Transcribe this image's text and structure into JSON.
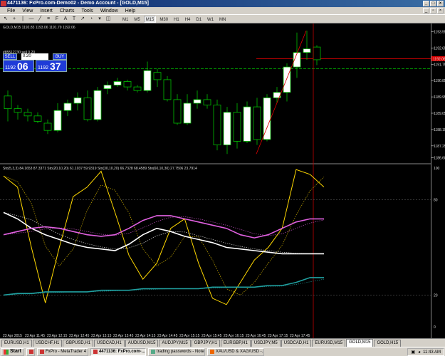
{
  "window": {
    "title": "4471136: FxPro.com-Demo02 - Demo Account - [GOLD,M15]"
  },
  "menu": [
    "File",
    "View",
    "Insert",
    "Charts",
    "Tools",
    "Window",
    "Help"
  ],
  "timeframes": [
    "M1",
    "M5",
    "M15",
    "M30",
    "H1",
    "H4",
    "D1",
    "W1",
    "MN"
  ],
  "active_timeframe": "M15",
  "chart": {
    "symbol_info": "GOLD,M15  1192.83 1193.06 1191.79 1192.06",
    "order_line_label": "#85512730 sell 0.20",
    "one_click": {
      "sell_label": "SELL",
      "buy_label": "BUY",
      "lot": "0.20",
      "sell_price_small": "1192",
      "sell_price_big": "06",
      "buy_price_small": "1192",
      "buy_price_big": "37"
    },
    "indicator_label": "Sto(5,3,3) 84.1653 87.3371  Sto(20,10,20) 61.1037 59.9319  Sto(30,10,20) 66.7328 68.4589  Sto(60,10,30) 27.7506 23.7914",
    "colors": {
      "background": "#000000",
      "bull_candle": "#ffffff",
      "bear_candle": "#000000",
      "candle_outline": "#00c000",
      "sto_5": "#ffd800",
      "sto_20": "#ffffff",
      "sto_30": "#e060e0",
      "sto_60": "#20a0a0",
      "order_line": "#00c000",
      "bid_line": "#ff0000",
      "crosshair": "#c00000"
    }
  },
  "chart_data": {
    "type": "candlestick",
    "price_levels": [
      "1193.55",
      "1192.65",
      "1191.75",
      "1190.85",
      "1189.95",
      "1189.05",
      "1188.15",
      "1187.25",
      "1186.60"
    ],
    "current_price_label": "1192.06",
    "crosshair_price_label": "1192.65",
    "indicator_levels": [
      "100",
      "80",
      "20",
      "0"
    ],
    "time_labels": [
      "23 Apr 2015",
      "23 Apr 11:45",
      "23 Apr 12:15",
      "23 Apr 12:45",
      "23 Apr 13:15",
      "23 Apr 13:45",
      "23 Apr 14:15",
      "23 Apr 14:45",
      "23 Apr 15:15",
      "23 Apr 15:45",
      "23 Apr 16:15",
      "23 Apr 16:45",
      "23 Apr 17:15",
      "23 Apr 17:45"
    ],
    "candles": [
      [
        1190.0,
        1190.3,
        1188.6,
        1189.3
      ],
      [
        1189.3,
        1189.5,
        1188.7,
        1189.1
      ],
      [
        1189.1,
        1189.3,
        1188.6,
        1188.9
      ],
      [
        1188.9,
        1189.1,
        1188.5,
        1188.6
      ],
      [
        1188.5,
        1188.7,
        1187.9,
        1188.1
      ],
      [
        1188.1,
        1189.6,
        1188.0,
        1189.2
      ],
      [
        1189.2,
        1189.8,
        1188.9,
        1189.6
      ],
      [
        1189.6,
        1190.2,
        1189.2,
        1189.9
      ],
      [
        1189.9,
        1190.3,
        1188.6,
        1188.7
      ],
      [
        1188.7,
        1190.5,
        1188.6,
        1190.3
      ],
      [
        1190.4,
        1190.8,
        1190.1,
        1190.6
      ],
      [
        1190.6,
        1191.0,
        1190.5,
        1190.8
      ],
      [
        1190.8,
        1190.9,
        1190.3,
        1190.5
      ],
      [
        1190.5,
        1190.6,
        1190.2,
        1190.3
      ],
      [
        1190.3,
        1191.9,
        1190.2,
        1191.4
      ],
      [
        1191.3,
        1191.5,
        1190.5,
        1190.9
      ],
      [
        1190.9,
        1191.1,
        1189.7,
        1189.8
      ],
      [
        1189.8,
        1190.1,
        1188.4,
        1188.5
      ],
      [
        1188.5,
        1190.1,
        1188.4,
        1189.6
      ],
      [
        1189.6,
        1190.3,
        1189.3,
        1189.8
      ],
      [
        1189.8,
        1190.1,
        1189.3,
        1189.5
      ],
      [
        1189.5,
        1189.8,
        1187.0,
        1187.3
      ],
      [
        1187.3,
        1189.4,
        1186.8,
        1189.1
      ],
      [
        1189.1,
        1189.6,
        1187.1,
        1187.5
      ],
      [
        1187.5,
        1189.7,
        1187.4,
        1189.4
      ],
      [
        1189.4,
        1189.9,
        1187.3,
        1187.6
      ],
      [
        1187.6,
        1190.1,
        1187.5,
        1189.9
      ],
      [
        1189.9,
        1190.5,
        1189.6,
        1190.2
      ],
      [
        1190.2,
        1191.8,
        1189.7,
        1191.6
      ],
      [
        1191.6,
        1193.5,
        1191.0,
        1192.4
      ],
      [
        1192.4,
        1193.6,
        1192.0,
        1192.6
      ],
      [
        1192.7,
        1192.8,
        1191.7,
        1192.0
      ]
    ],
    "series": [
      {
        "name": "Sto(5,3,3)",
        "values": [
          95,
          88,
          50,
          15,
          50,
          82,
          88,
          98,
          72,
          45,
          30,
          40,
          62,
          68,
          40,
          18,
          14,
          28,
          42,
          50,
          62,
          99,
          96,
          88
        ]
      },
      {
        "name": "Sto(20,10,20)",
        "values": [
          72,
          68,
          62,
          58,
          55,
          52,
          50,
          49,
          48,
          52,
          58,
          62,
          60,
          57,
          55,
          53,
          50,
          49,
          48,
          47,
          46,
          46,
          46,
          46
        ]
      },
      {
        "name": "Sto(30,10,20)",
        "values": [
          58,
          60,
          62,
          63,
          62,
          60,
          58,
          57,
          58,
          62,
          67,
          70,
          70,
          68,
          66,
          64,
          62,
          58,
          56,
          58,
          62,
          66,
          68,
          68
        ]
      },
      {
        "name": "Sto(60,10,30)",
        "values": [
          20,
          21,
          21,
          22,
          22,
          22,
          22,
          23,
          23,
          23,
          24,
          24,
          24,
          24,
          24,
          25,
          25,
          25,
          25,
          26,
          26,
          28,
          31,
          31
        ]
      }
    ]
  },
  "tabs": [
    "EURUSD,H1",
    "USDCHF,H1",
    "GBPUSD,H1",
    "USDCAD,H1",
    "AUDUSD,M15",
    "AUDJPY,M15",
    "GBPJPY,H1",
    "EURGBP,H1",
    "USDJPY,M5",
    "USDCAD,H1",
    "EURUSD,M15",
    "GOLD,M15",
    "GOLD,H15"
  ],
  "active_tab": "GOLD,M15",
  "taskbar": {
    "start_label": "Start",
    "tasks": [
      "FxPro - MetaTrader 4",
      "4471136: FxPro.com-...",
      "trading passwords - Notep...",
      "XAU/USD & XAG/USD -..."
    ],
    "active_task": "4471136: FxPro.com-...",
    "clock": "11:43 AM"
  }
}
